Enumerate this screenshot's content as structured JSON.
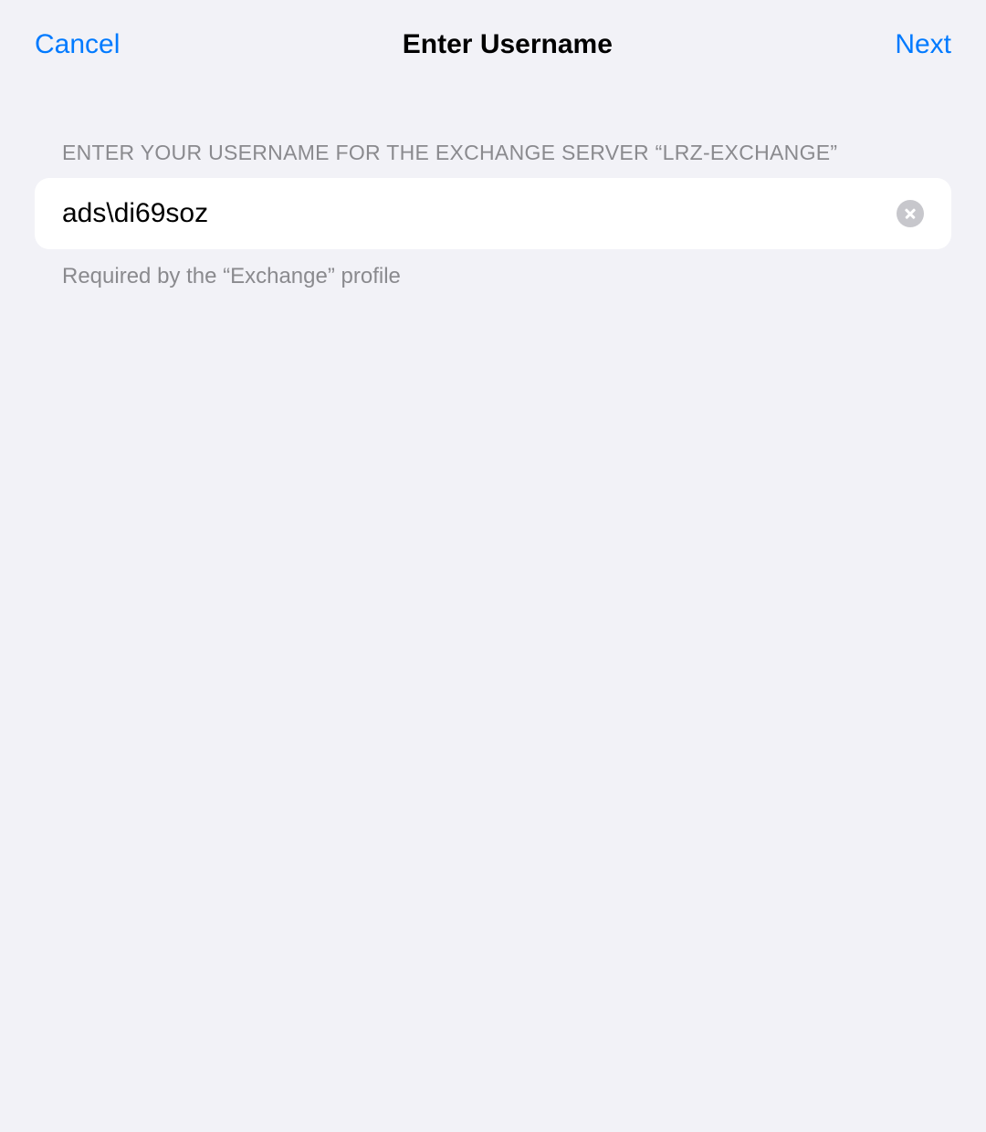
{
  "header": {
    "cancel_label": "Cancel",
    "title": "Enter Username",
    "next_label": "Next"
  },
  "form": {
    "section_header": "ENTER YOUR USERNAME FOR THE EXCHANGE SERVER “LRZ-EXCHANGE”",
    "username_value": "ads\\di69soz",
    "footer_text": "Required by the “Exchange” profile"
  }
}
